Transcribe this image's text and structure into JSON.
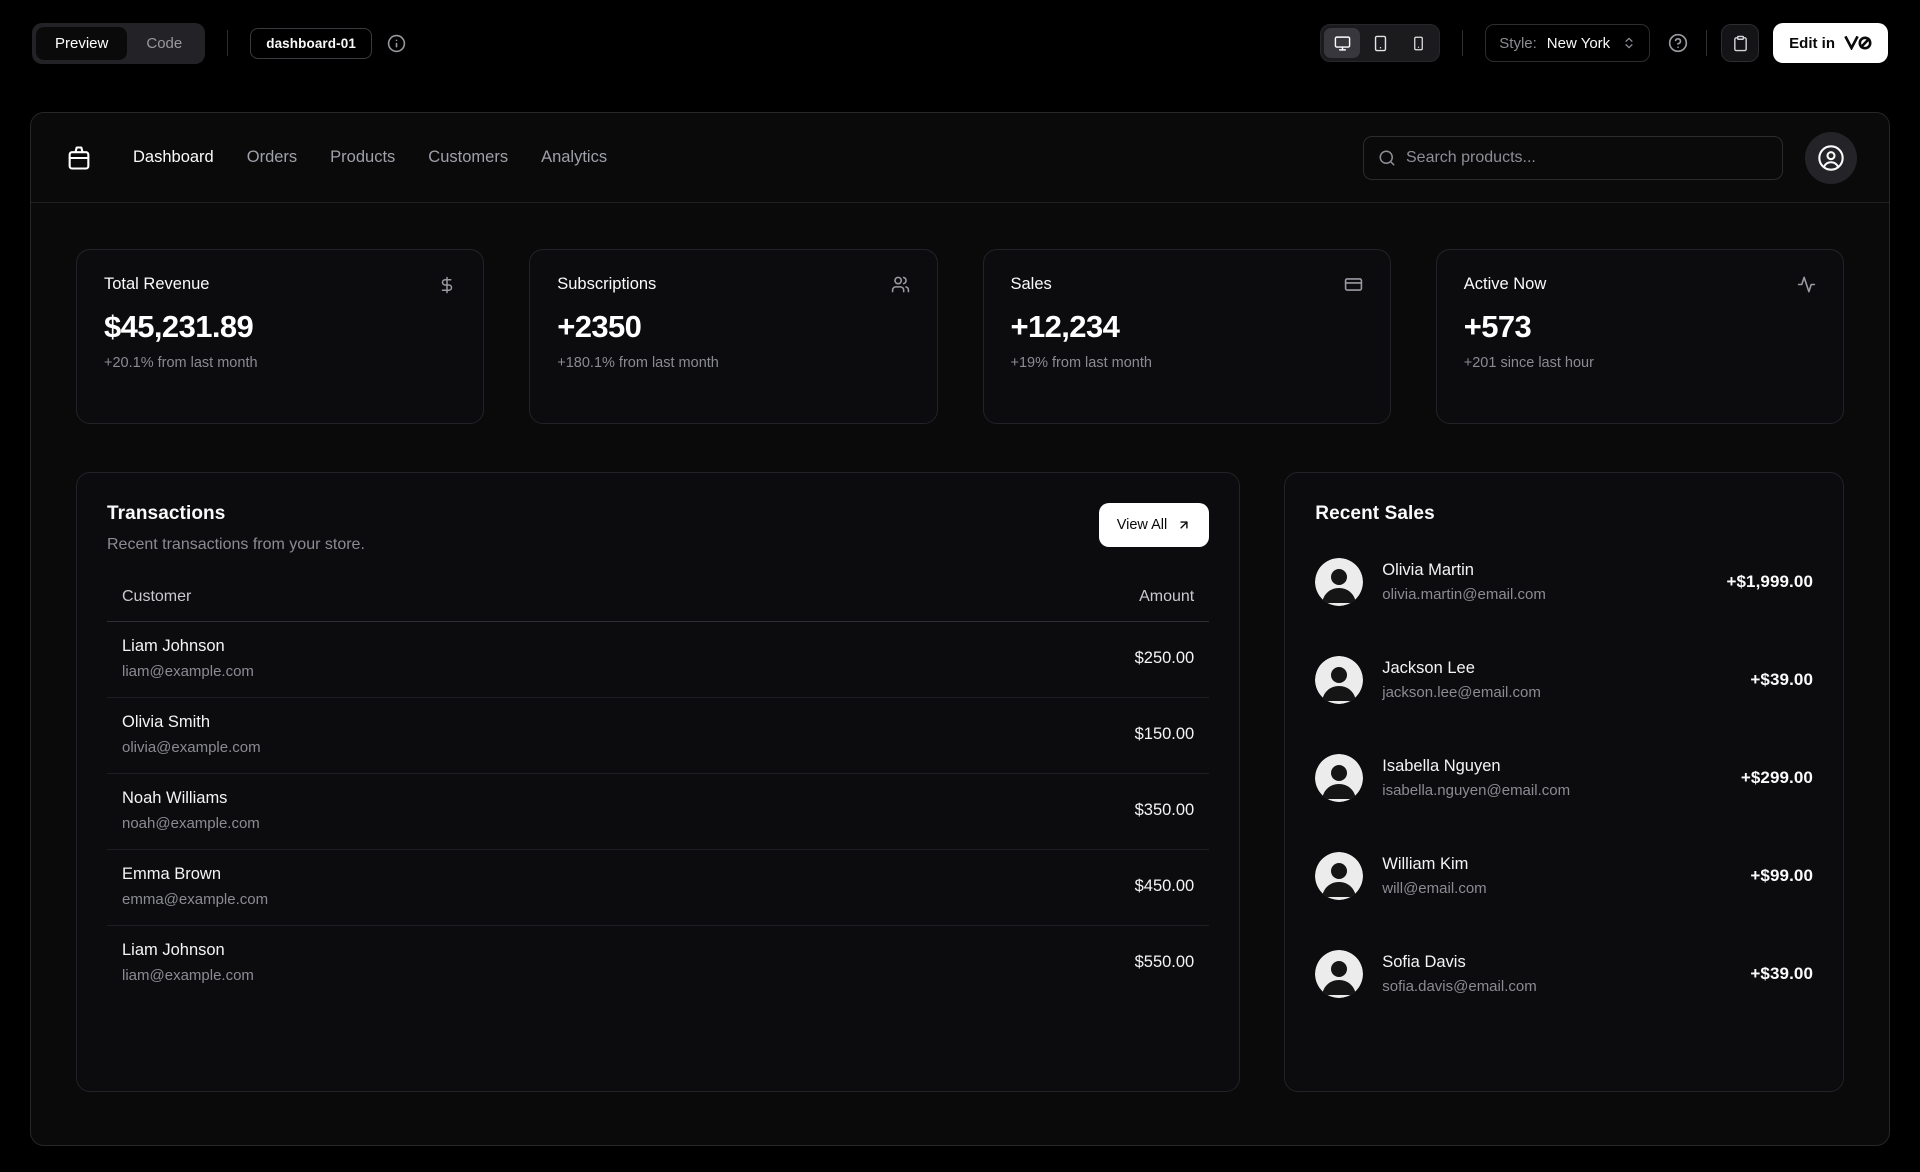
{
  "toolbar": {
    "preview_label": "Preview",
    "code_label": "Code",
    "block_badge": "dashboard-01",
    "style_label": "Style:",
    "style_value": "New York",
    "edit_label": "Edit in",
    "edit_logo": "v0",
    "viewport_options": [
      "desktop",
      "tablet",
      "mobile"
    ],
    "viewport_active": "desktop"
  },
  "nav": {
    "items": [
      {
        "label": "Dashboard",
        "active": true
      },
      {
        "label": "Orders",
        "active": false
      },
      {
        "label": "Products",
        "active": false
      },
      {
        "label": "Customers",
        "active": false
      },
      {
        "label": "Analytics",
        "active": false
      }
    ],
    "search_placeholder": "Search products..."
  },
  "stats": [
    {
      "title": "Total Revenue",
      "icon": "dollar-sign-icon",
      "value": "$45,231.89",
      "change": "+20.1% from last month"
    },
    {
      "title": "Subscriptions",
      "icon": "users-icon",
      "value": "+2350",
      "change": "+180.1% from last month"
    },
    {
      "title": "Sales",
      "icon": "credit-card-icon",
      "value": "+12,234",
      "change": "+19% from last month"
    },
    {
      "title": "Active Now",
      "icon": "activity-icon",
      "value": "+573",
      "change": "+201 since last hour"
    }
  ],
  "transactions": {
    "title": "Transactions",
    "subtitle": "Recent transactions from your store.",
    "view_all_label": "View All",
    "columns": [
      "Customer",
      "Amount"
    ],
    "rows": [
      {
        "name": "Liam Johnson",
        "email": "liam@example.com",
        "amount": "$250.00"
      },
      {
        "name": "Olivia Smith",
        "email": "olivia@example.com",
        "amount": "$150.00"
      },
      {
        "name": "Noah Williams",
        "email": "noah@example.com",
        "amount": "$350.00"
      },
      {
        "name": "Emma Brown",
        "email": "emma@example.com",
        "amount": "$450.00"
      },
      {
        "name": "Liam Johnson",
        "email": "liam@example.com",
        "amount": "$550.00"
      }
    ]
  },
  "recent_sales": {
    "title": "Recent Sales",
    "items": [
      {
        "name": "Olivia Martin",
        "email": "olivia.martin@email.com",
        "amount": "+$1,999.00"
      },
      {
        "name": "Jackson Lee",
        "email": "jackson.lee@email.com",
        "amount": "+$39.00"
      },
      {
        "name": "Isabella Nguyen",
        "email": "isabella.nguyen@email.com",
        "amount": "+$299.00"
      },
      {
        "name": "William Kim",
        "email": "will@email.com",
        "amount": "+$99.00"
      },
      {
        "name": "Sofia Davis",
        "email": "sofia.davis@email.com",
        "amount": "+$39.00"
      }
    ]
  },
  "colors": {
    "page_bg": "#000000",
    "panel_bg": "#0a0a0b",
    "card_bg": "#0c0c0e",
    "card_border": "#222228",
    "accent": "#ffffff",
    "muted_text": "#8b8b93"
  }
}
